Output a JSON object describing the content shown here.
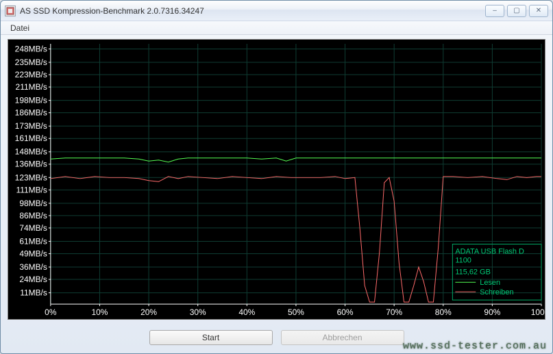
{
  "window": {
    "title": "AS SSD Kompression-Benchmark 2.0.7316.34247",
    "min_icon": "–",
    "max_icon": "▢",
    "close_icon": "✕"
  },
  "menu": {
    "file": "Datei"
  },
  "buttons": {
    "start": "Start",
    "cancel": "Abbrechen"
  },
  "watermark": "www.ssd-tester.com.au",
  "legend": {
    "device": "ADATA USB Flash D",
    "firmware": "1100",
    "capacity": "115,62 GB",
    "read": "Lesen",
    "write": "Schreiben"
  },
  "chart_data": {
    "type": "line",
    "title": "",
    "xlabel": "",
    "ylabel": "",
    "x_ticks": [
      "0%",
      "10%",
      "20%",
      "30%",
      "40%",
      "50%",
      "60%",
      "70%",
      "80%",
      "90%",
      "100%"
    ],
    "y_ticks_mb_s": [
      11,
      24,
      36,
      49,
      61,
      74,
      86,
      98,
      111,
      123,
      136,
      148,
      161,
      173,
      186,
      198,
      211,
      223,
      235,
      248
    ],
    "ylim": [
      0,
      253
    ],
    "xlim": [
      0,
      100
    ],
    "series": [
      {
        "name": "Lesen",
        "color": "#54ff54",
        "x": [
          0,
          3,
          6,
          9,
          12,
          15,
          18,
          20,
          22,
          24,
          26,
          28,
          31,
          34,
          37,
          40,
          43,
          46,
          48,
          50,
          53,
          56,
          59,
          62,
          65,
          68,
          71,
          74,
          77,
          80,
          83,
          86,
          89,
          92,
          95,
          98,
          100
        ],
        "y": [
          141,
          142,
          142,
          142,
          142,
          142,
          141,
          139,
          140,
          138,
          141,
          142,
          142,
          142,
          142,
          142,
          141,
          142,
          139,
          142,
          142,
          142,
          142,
          142,
          142,
          142,
          142,
          142,
          142,
          142,
          142,
          142,
          142,
          142,
          142,
          142,
          142
        ]
      },
      {
        "name": "Schreiben",
        "color": "#ff6a6a",
        "x": [
          0,
          3,
          6,
          9,
          12,
          15,
          18,
          20,
          22,
          24,
          26,
          28,
          31,
          34,
          37,
          40,
          43,
          46,
          49,
          52,
          55,
          58,
          60,
          62,
          63,
          64,
          65,
          66,
          67,
          68,
          69,
          70,
          71,
          72,
          73,
          74,
          75,
          76,
          77,
          78,
          79,
          80,
          82,
          85,
          88,
          91,
          93,
          95,
          97,
          99,
          100
        ],
        "y": [
          122,
          124,
          122,
          124,
          123,
          123,
          122,
          120,
          119,
          124,
          122,
          124,
          123,
          122,
          124,
          123,
          122,
          124,
          123,
          123,
          123,
          124,
          122,
          123,
          75,
          18,
          2,
          2,
          50,
          118,
          123,
          100,
          40,
          2,
          2,
          18,
          36,
          22,
          2,
          2,
          55,
          124,
          124,
          123,
          124,
          122,
          121,
          124,
          123,
          124,
          124
        ]
      }
    ]
  }
}
